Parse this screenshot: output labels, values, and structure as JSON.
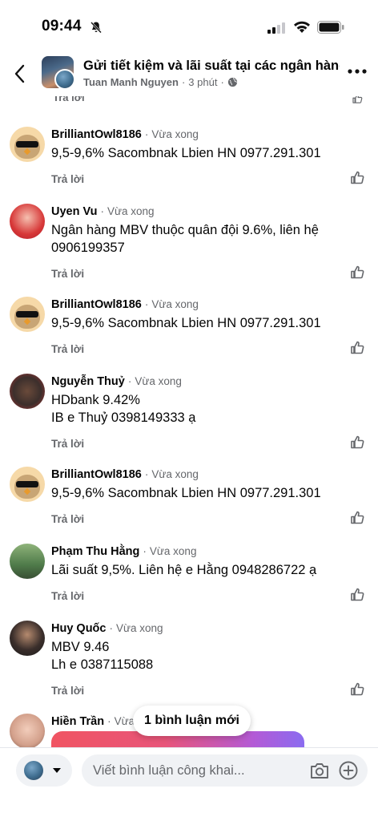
{
  "status": {
    "time": "09:44"
  },
  "header": {
    "title": "Gửi tiết kiệm và lãi suất tại các ngân hàng",
    "author": "Tuan Manh Nguyen",
    "separator": "·",
    "time": "3 phút",
    "separator2": "·"
  },
  "partial": {
    "reply": "Trả lời"
  },
  "comments": [
    {
      "name": "BrilliantOwl8186",
      "dot": "·",
      "time": "Vừa xong",
      "text": "9,5-9,6% Sacombnak Lbien HN 0977.291.301",
      "reply": "Trả lời"
    },
    {
      "name": "Uyen Vu",
      "dot": "·",
      "time": "Vừa xong",
      "text": "Ngân hàng MBV thuộc quân đội 9.6%, liên hệ 0906199357",
      "reply": "Trả lời"
    },
    {
      "name": "BrilliantOwl8186",
      "dot": "·",
      "time": "Vừa xong",
      "text": "9,5-9,6% Sacombnak Lbien HN 0977.291.301",
      "reply": "Trả lời"
    },
    {
      "name": "Nguyễn Thuỷ",
      "dot": "·",
      "time": "Vừa xong",
      "text_line1": "HDbank 9.42%",
      "text_line2": "IB e Thuỷ 0398149333 ạ",
      "reply": "Trả lời"
    },
    {
      "name": "BrilliantOwl8186",
      "dot": "·",
      "time": "Vừa xong",
      "text": "9,5-9,6% Sacombnak Lbien HN 0977.291.301",
      "reply": "Trả lời"
    },
    {
      "name": "Phạm Thu Hằng",
      "dot": "·",
      "time": "Vừa xong",
      "text": "Lãi suất 9,5%. Liên hệ e Hằng 0948286722 ạ",
      "reply": "Trả lời"
    },
    {
      "name": "Huy Quốc",
      "dot": "·",
      "time": "Vừa xong",
      "text_line1": "MBV 9.46",
      "text_line2": "Lh e 0387115088",
      "reply": "Trả lời"
    },
    {
      "name": "Hiền Trần",
      "dot": "·",
      "time": "Vừa"
    }
  ],
  "new_comments_pill": "1 bình luận mới",
  "composer": {
    "placeholder": "Viết bình luận công khai..."
  },
  "icons": {
    "back": "chevron-left-icon",
    "more": "more-horizontal-icon",
    "globe": "globe-icon",
    "like": "thumbs-up-icon",
    "camera": "camera-icon",
    "add": "plus-circle-icon",
    "bell_off": "bell-slash-icon",
    "signal": "cellular-signal-icon",
    "wifi": "wifi-icon",
    "battery": "battery-icon"
  },
  "colors": {
    "secondary_text": "#65676b",
    "input_bg": "#f0f2f5",
    "primary_text": "#050505"
  }
}
